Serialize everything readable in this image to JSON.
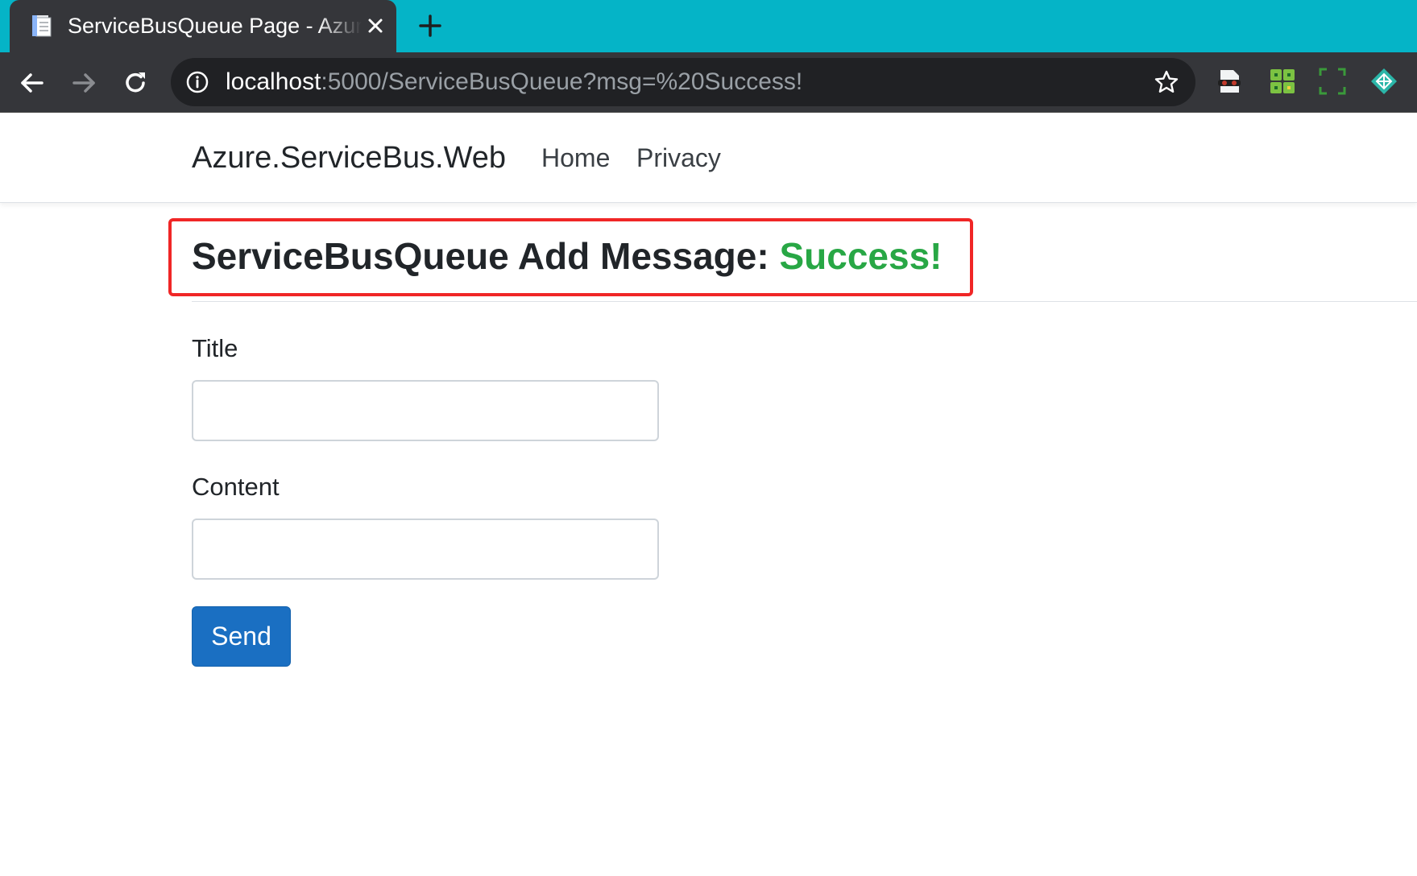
{
  "browser": {
    "tab": {
      "title": "ServiceBusQueue Page - Azure.ServiceBus.Web",
      "close_glyph": "✕",
      "favicon": "document-icon"
    },
    "new_tab": "plus-icon",
    "nav": {
      "back": "back-arrow-icon",
      "forward": "forward-arrow-icon",
      "reload": "reload-icon"
    },
    "omnibox": {
      "host": "localhost",
      "rest": ":5000/ServiceBusQueue?msg=%20Success!",
      "info": "info-icon",
      "bookmark": "star-icon"
    },
    "extensions": [
      "incognito-extension-icon",
      "grid-extension-icon",
      "screenshot-extension-icon",
      "diamond-extension-icon"
    ],
    "colors": {
      "tabstrip": "#05b4c7",
      "toolbar": "#35363a",
      "omnibox": "#202124"
    }
  },
  "site": {
    "brand": "Azure.ServiceBus.Web",
    "nav": [
      {
        "label": "Home"
      },
      {
        "label": "Privacy"
      }
    ]
  },
  "main": {
    "heading_prefix": "ServiceBusQueue Add Message: ",
    "heading_status": "Success!",
    "status_color": "#28a745",
    "highlight_color": "#f02626",
    "form": {
      "title_label": "Title",
      "title_value": "",
      "content_label": "Content",
      "content_value": "",
      "send_label": "Send"
    }
  }
}
